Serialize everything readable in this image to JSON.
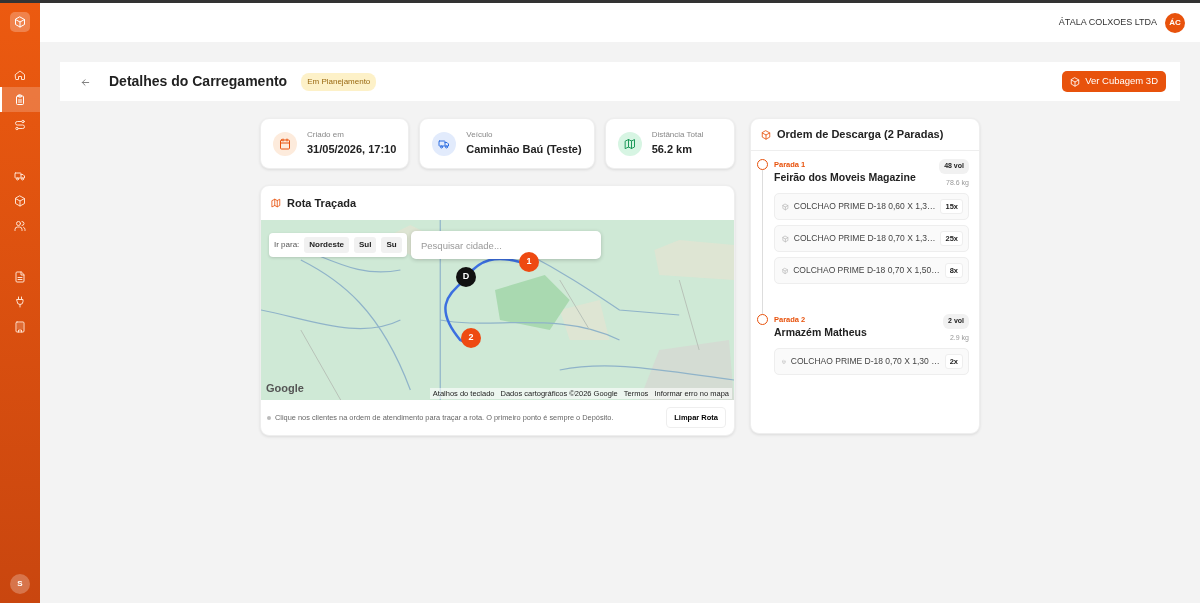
{
  "sidebar": {
    "items": [
      {
        "selected": false
      },
      {
        "selected": true
      },
      {
        "selected": false
      },
      {
        "selected": false
      },
      {
        "selected": false
      },
      {
        "selected": false
      },
      {
        "selected": false
      },
      {
        "selected": false
      },
      {
        "selected": false
      }
    ],
    "user_initial": "S"
  },
  "topbar": {
    "company": "ÁTALA COLXOES LTDA",
    "avatar": "ÁC"
  },
  "header": {
    "title": "Detalhes do Carregamento",
    "status": "Em Planejamento",
    "button": "Ver Cubagem 3D"
  },
  "stats": [
    {
      "label": "Criado em",
      "value": "31/05/2026, 17:10"
    },
    {
      "label": "Veículo",
      "value": "Caminhão Baú (Teste)"
    },
    {
      "label": "Distância Total",
      "value": "56.2 km"
    }
  ],
  "route": {
    "title": "Rota Traçada",
    "goto_label": "Ir para:",
    "goto_chips": [
      "Nordeste",
      "Sul",
      "Su"
    ],
    "search": {
      "placeholder": "Pesquisar cidade..."
    },
    "markers": [
      {
        "label": "D",
        "kind": "depot"
      },
      {
        "label": "1",
        "kind": "stop"
      },
      {
        "label": "2",
        "kind": "stop"
      }
    ],
    "map_logo": "Google",
    "attribution": [
      "Atalhos do teclado",
      "Dados cartográficos ©2026 Google",
      "Termos",
      "Informar erro no mapa"
    ],
    "hint": "Clique nos clientes na ordem de atendimento para traçar a rota. O primeiro ponto é sempre o Depósito.",
    "clear_button": "Limpar Rota"
  },
  "unload": {
    "title": "Ordem de Descarga (2 Paradas)",
    "stops": [
      {
        "label": "Parada 1",
        "name": "Feirão dos Moveis Magazine",
        "volume": "48 vol",
        "weight": "78.6 kg",
        "items": [
          {
            "name": "COLCHAO PRIME D-18 0,60 X 1,3…",
            "qty": "15x"
          },
          {
            "name": "COLCHAO PRIME D-18 0,70 X 1,3…",
            "qty": "25x"
          },
          {
            "name": "COLCHAO PRIME D-18 0,70 X 1,50…",
            "qty": "8x"
          }
        ]
      },
      {
        "label": "Parada 2",
        "name": "Armazém Matheus",
        "volume": "2 vol",
        "weight": "2.9 kg",
        "items": [
          {
            "name": "COLCHAO PRIME D-18 0,70 X 1,30 …",
            "qty": "2x"
          }
        ]
      }
    ]
  }
}
